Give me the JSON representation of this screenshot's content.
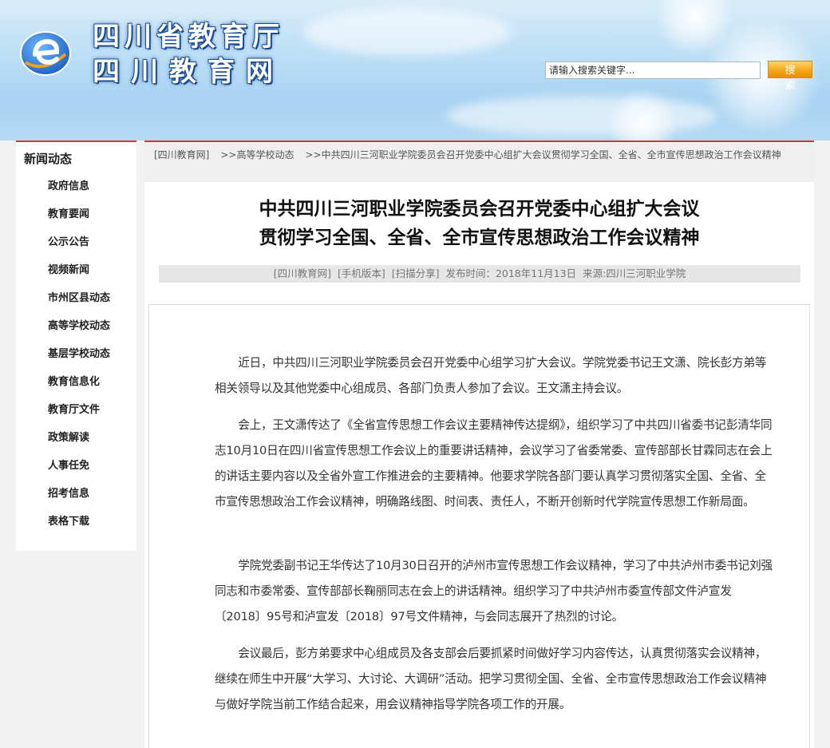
{
  "header": {
    "logo_line1": "四川省教育厅",
    "logo_line2": "四川教育网",
    "search_placeholder": "请输入搜索关键字...",
    "search_button": "搜 索"
  },
  "sidebar": {
    "title": "新闻动态",
    "items": [
      {
        "label": "政府信息"
      },
      {
        "label": "教育要闻"
      },
      {
        "label": "公示公告"
      },
      {
        "label": "视频新闻"
      },
      {
        "label": "市州区县动态"
      },
      {
        "label": "高等学校动态"
      },
      {
        "label": "基层学校动态"
      },
      {
        "label": "教育信息化"
      },
      {
        "label": "教育厅文件"
      },
      {
        "label": "政策解读"
      },
      {
        "label": "人事任免"
      },
      {
        "label": "招考信息"
      },
      {
        "label": "表格下载"
      }
    ]
  },
  "breadcrumb": {
    "home": "[四川教育网]",
    "section": ">>高等学校动态",
    "current": ">>中共四川三河职业学院委员会召开党委中心组扩大会议贯彻学习全国、全省、全市宣传思想政治工作会议精神"
  },
  "article": {
    "title_line1": "中共四川三河职业学院委员会召开党委中心组扩大会议",
    "title_line2": "贯彻学习全国、全省、全市宣传思想政治工作会议精神",
    "meta": {
      "site_link": "[四川教育网]",
      "mobile_link": "[手机版本]",
      "qr_link": "[扫描分享]",
      "publish_time": "发布时间：2018年11月13日",
      "source": "来源:四川三河职业学院"
    },
    "paragraphs": [
      "近日，中共四川三河职业学院委员会召开党委中心组学习扩大会议。学院党委书记王文潇、院长彭方弟等相关领导以及其他党委中心组成员、各部门负责人参加了会议。王文潇主持会议。",
      "会上，王文潇传达了《全省宣传思想工作会议主要精神传达提纲》，组织学习了中共四川省委书记彭清华同志10月10日在四川省宣传思想工作会议上的重要讲话精神，会议学习了省委常委、宣传部部长甘霖同志在会上的讲话主要内容以及全省外宣工作推进会的主要精神。他要求学院各部门要认真学习贯彻落实全国、全省、全市宣传思想政治工作会议精神，明确路线图、时间表、责任人，不断开创新时代学院宣传思想工作新局面。",
      "学院党委副书记王华传达了10月30日召开的泸州市宣传思想工作会议精神，学习了中共泸州市委书记刘强同志和市委常委、宣传部部长鞠丽同志在会上的讲话精神。组织学习了中共泸州市委宣传部文件泸宣发〔2018〕95号和泸宣发〔2018〕97号文件精神，与会同志展开了热烈的讨论。",
      "会议最后，彭方弟要求中心组成员及各支部会后要抓紧时间做好学习内容传达，认真贯彻落实会议精神，继续在师生中开展“大学习、大讨论、大调研”活动。把学习贯彻全国、全省、全市宣传思想政治工作会议精神与做好学院当前工作结合起来，用会议精神指导学院各项工作的开展。"
    ]
  },
  "icons": {
    "logo": "e-logo-icon"
  },
  "colors": {
    "accent_red": "#d93434",
    "search_orange": "#f5a413",
    "logo_blue": "#1c4e95"
  }
}
